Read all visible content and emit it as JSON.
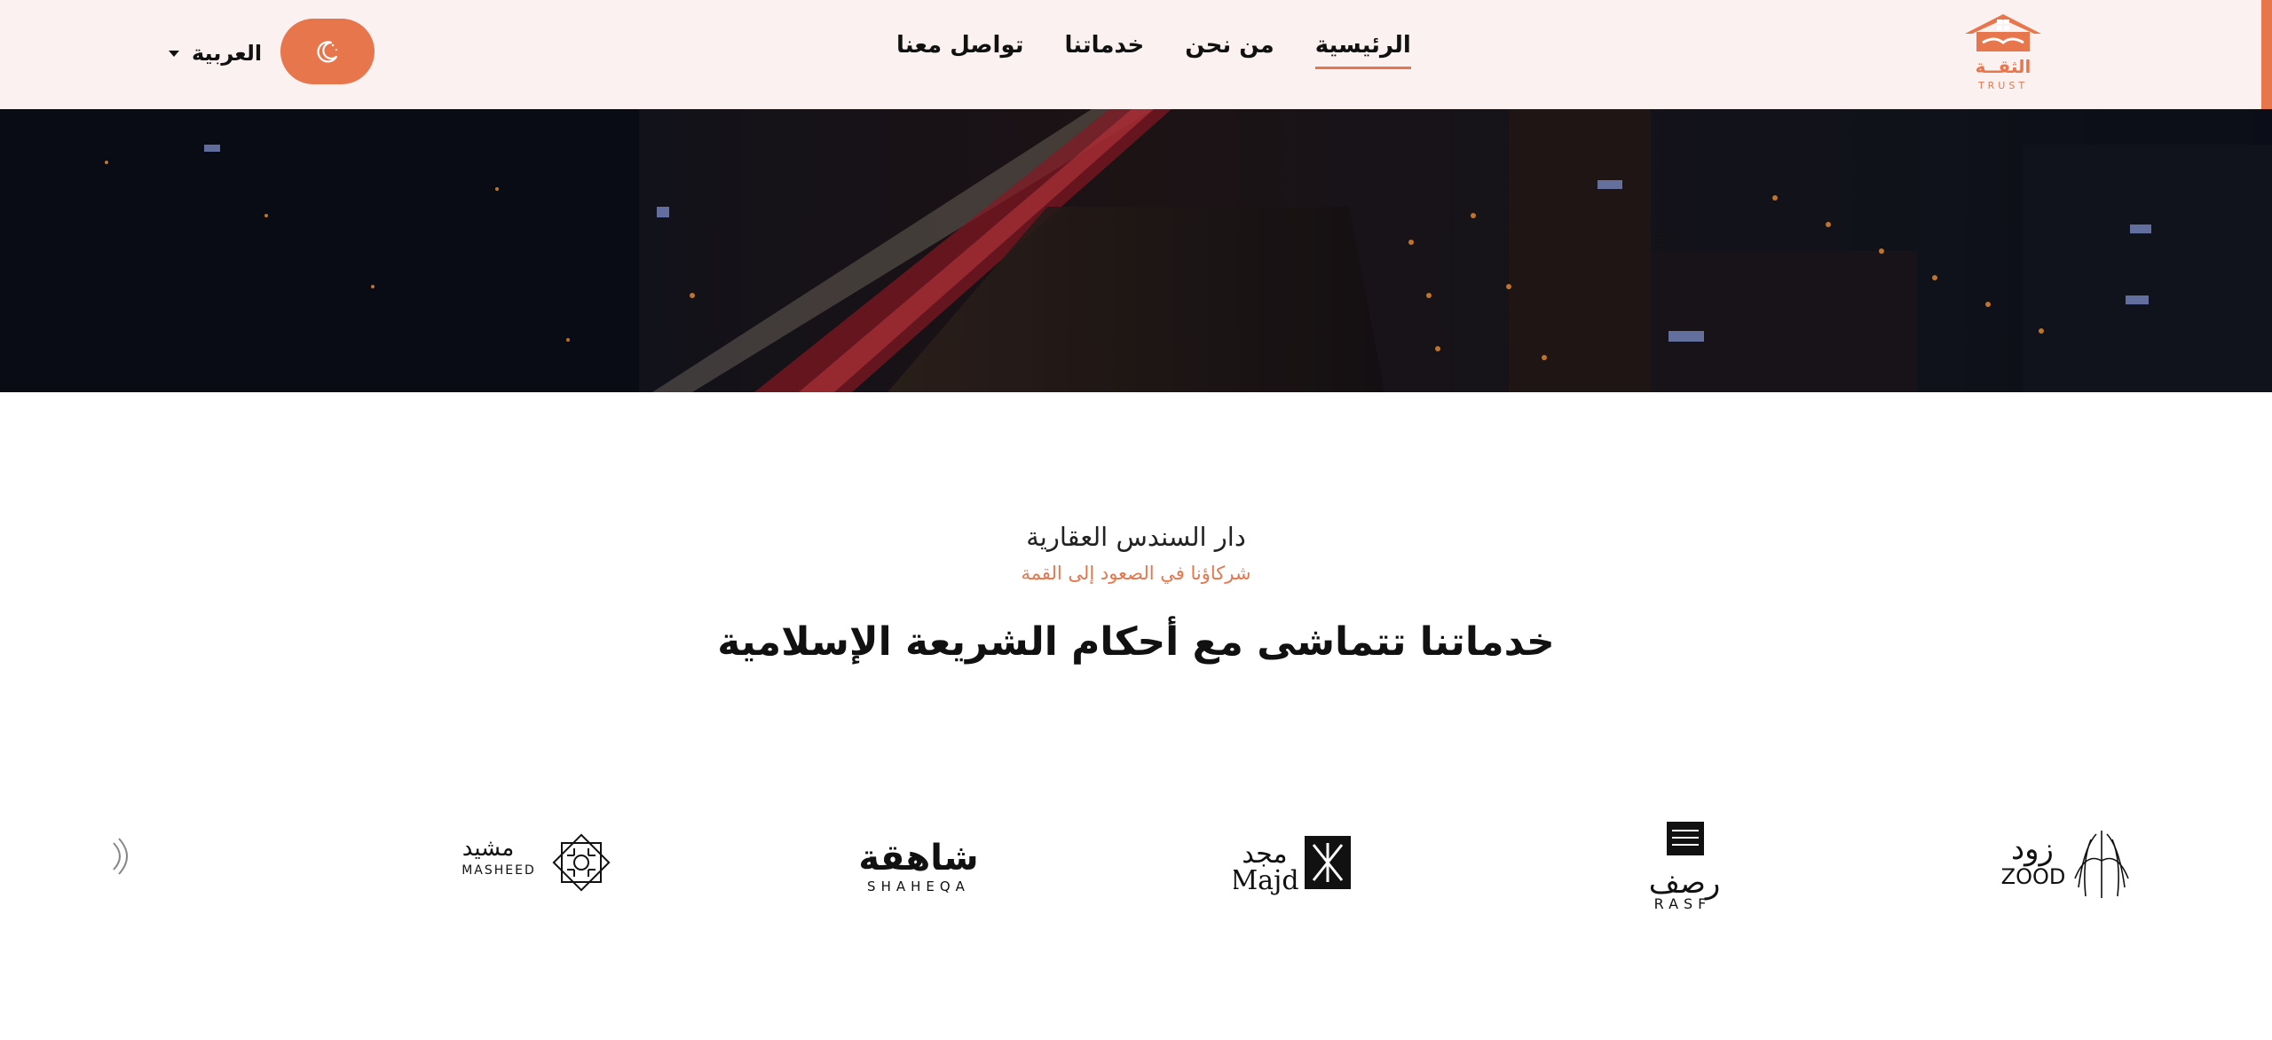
{
  "nav": {
    "language_label": "العربية",
    "items": [
      {
        "label": "الرئيسية",
        "active": true
      },
      {
        "label": "من نحن",
        "active": false
      },
      {
        "label": "خدماتنا",
        "active": false
      },
      {
        "label": "تواصل معنا",
        "active": false
      }
    ],
    "theme_toggle_icon": "moon-stars-icon",
    "logo": {
      "arabic": "الثقــة",
      "latin": "TRUST"
    }
  },
  "intro": {
    "company": "دار السندس العقارية",
    "tagline": "شركاؤنا في الصعود إلى القمة",
    "headline": "خدماتنا تتماشى مع أحكام الشريعة الإسلامية"
  },
  "partners": [
    {
      "latin": "ZOOD",
      "arabic": "زود"
    },
    {
      "latin": "RASF",
      "arabic": "رصف"
    },
    {
      "latin": "Majd",
      "arabic": "مجد"
    },
    {
      "latin": "SHAHEQA",
      "arabic": "شاهقة"
    },
    {
      "latin": "MASHEED",
      "arabic": "مشيد"
    }
  ],
  "colors": {
    "accent": "#e8764d",
    "nav_bg": "#fbf1f1"
  }
}
